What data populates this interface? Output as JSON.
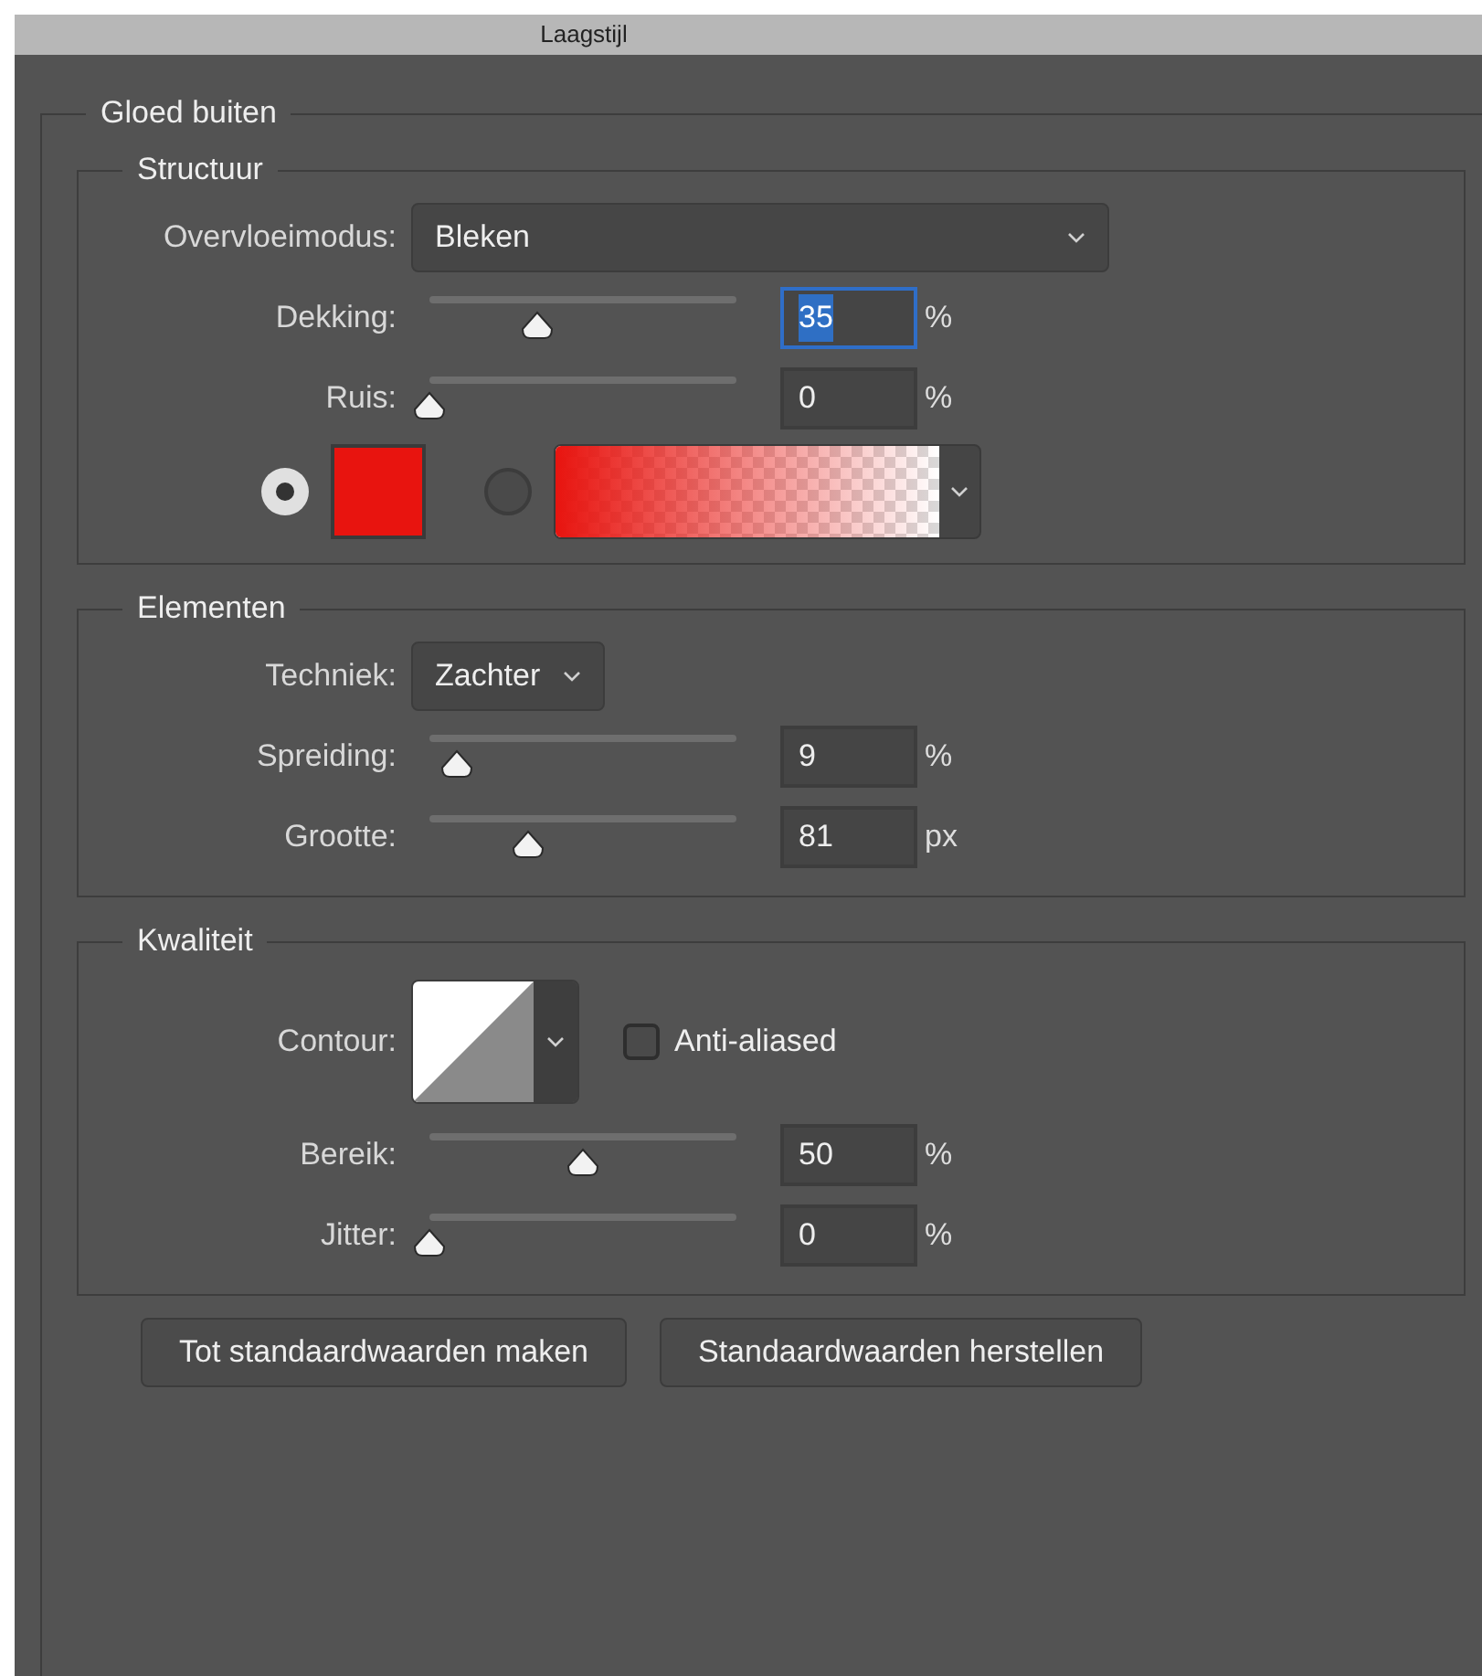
{
  "window": {
    "title": "Laagstijl"
  },
  "panel": {
    "title": "Gloed buiten"
  },
  "sections": [
    {
      "title": "Structuur",
      "rows": [
        {
          "kind": "dropdown",
          "label": "Overvloeimodus:",
          "value": "Bleken"
        },
        {
          "kind": "slider",
          "label": "Dekking:",
          "level": 0.35,
          "value": "35",
          "unit": "%",
          "focused": true
        },
        {
          "kind": "slider",
          "label": "Ruis:",
          "level": 0,
          "value": "0",
          "unit": "%",
          "focused": false
        },
        {
          "kind": "fill-choice",
          "options": [
            {
              "kind": "swatch",
              "selected": true,
              "color": "#e8140f"
            },
            {
              "kind": "gradient",
              "selected": false,
              "color": "#e8140f"
            }
          ]
        }
      ]
    },
    {
      "title": "Elementen",
      "rows": [
        {
          "kind": "compact-dropdown",
          "label": "Techniek:",
          "value": "Zachter"
        },
        {
          "kind": "slider",
          "label": "Spreiding:",
          "level": 0.09,
          "value": "9",
          "unit": "%",
          "focused": false
        },
        {
          "kind": "slider",
          "label": "Grootte:",
          "level": 0.32,
          "value": "81",
          "unit": "px",
          "focused": false
        }
      ]
    },
    {
      "title": "Kwaliteit",
      "rows": [
        {
          "kind": "contour",
          "label": "Contour:",
          "checkbox": {
            "label": "Anti-aliased",
            "checked": false
          }
        },
        {
          "kind": "slider",
          "label": "Bereik:",
          "level": 0.5,
          "value": "50",
          "unit": "%",
          "focused": false
        },
        {
          "kind": "slider",
          "label": "Jitter:",
          "level": 0,
          "value": "0",
          "unit": "%",
          "focused": false
        }
      ]
    }
  ],
  "buttons": [
    "Tot standaardwaarden maken",
    "Standaardwaarden herstellen"
  ]
}
